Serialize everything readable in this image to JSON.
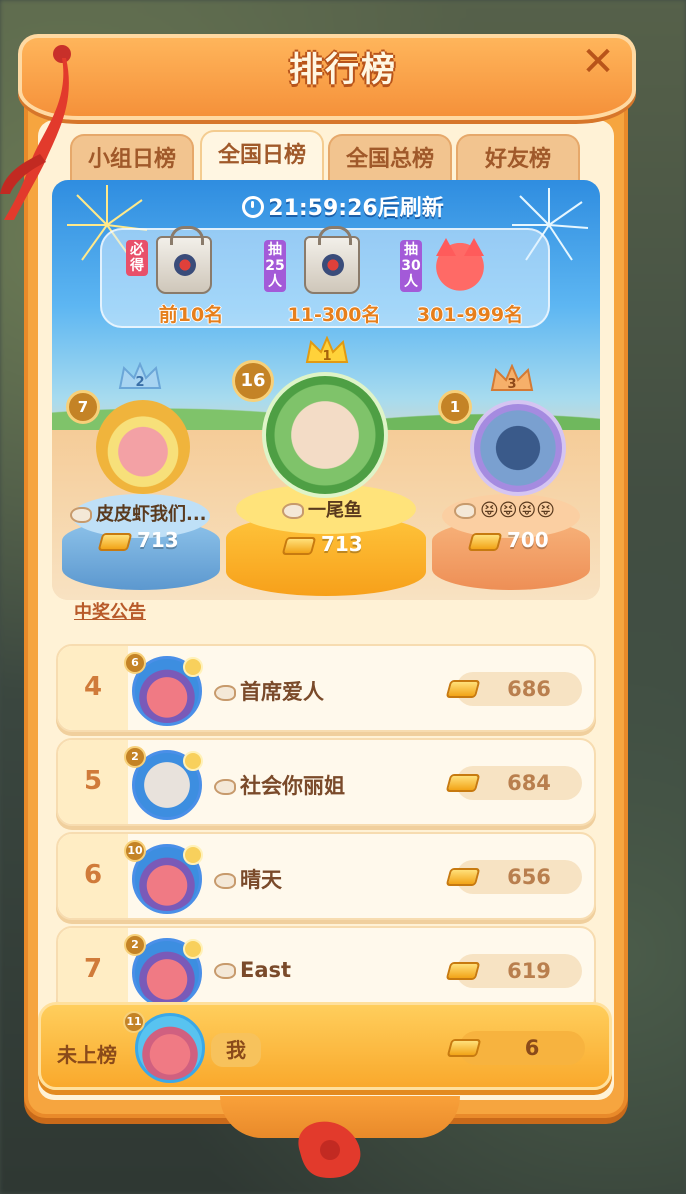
{
  "header": {
    "title": "排行榜",
    "close_label": "✕"
  },
  "tabs": [
    {
      "label": "小组日榜",
      "active": false
    },
    {
      "label": "全国日榜",
      "active": true
    },
    {
      "label": "全国总榜",
      "active": false
    },
    {
      "label": "好友榜",
      "active": false
    }
  ],
  "timer": {
    "text": "21:59:26后刷新"
  },
  "prizes": [
    {
      "tag": "必得",
      "tag_color": "#e8506a",
      "label": "前10名",
      "kind": "bag"
    },
    {
      "tag": "抽25人",
      "tag_color": "#a35ad8",
      "label": "11-300名",
      "kind": "bag"
    },
    {
      "tag": "抽30人",
      "tag_color": "#a35ad8",
      "label": "301-999名",
      "kind": "fox"
    }
  ],
  "podium": {
    "first": {
      "rank": "1",
      "level": "16",
      "name": "一尾鱼",
      "score": "713"
    },
    "second": {
      "rank": "2",
      "level": "7",
      "name": "皮皮虾我们...",
      "score": "713"
    },
    "third": {
      "rank": "3",
      "level": "1",
      "name": "😝😝😝😝",
      "score": "700"
    }
  },
  "notice_label": "中奖公告",
  "rows": [
    {
      "rank": "4",
      "level": "6",
      "name": "首席爱人",
      "score": "686"
    },
    {
      "rank": "5",
      "level": "2",
      "name": "社会你丽姐",
      "score": "684"
    },
    {
      "rank": "6",
      "level": "10",
      "name": "晴天",
      "score": "656"
    },
    {
      "rank": "7",
      "level": "2",
      "name": "East",
      "score": "619"
    }
  ],
  "me": {
    "rank_label": "未上榜",
    "level": "11",
    "name": "我",
    "score": "6"
  },
  "colors": {
    "accent": "#f6a53f",
    "panel": "#fff2d6",
    "text_brown": "#7a4a2a"
  }
}
